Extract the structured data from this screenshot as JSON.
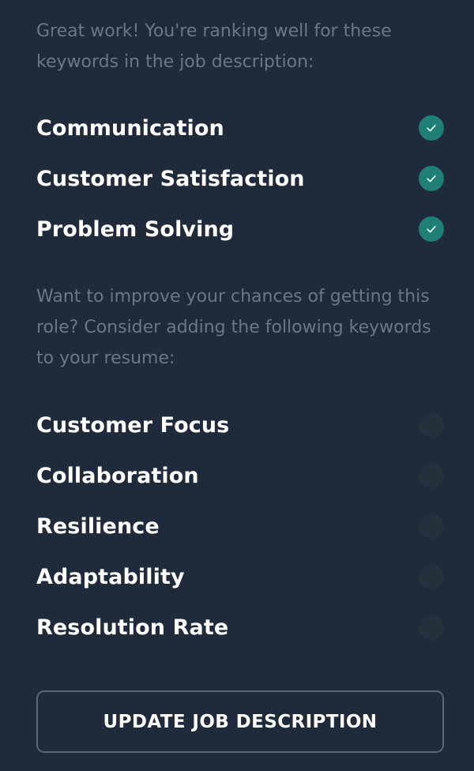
{
  "matched_section": {
    "intro": "Great work! You're ranking well for these keywords in the job description:",
    "keywords": [
      {
        "label": "Communication",
        "status": "matched",
        "icon": "check-icon"
      },
      {
        "label": "Customer Satisfaction",
        "status": "matched",
        "icon": "check-icon"
      },
      {
        "label": "Problem Solving",
        "status": "matched",
        "icon": "check-icon"
      }
    ]
  },
  "missing_section": {
    "intro": "Want to improve your chances of getting this role? Consider adding the following keywords to your resume:",
    "keywords": [
      {
        "label": "Customer Focus",
        "status": "missing"
      },
      {
        "label": "Collaboration",
        "status": "missing"
      },
      {
        "label": "Resilience",
        "status": "missing"
      },
      {
        "label": "Adaptability",
        "status": "missing"
      },
      {
        "label": "Resolution Rate",
        "status": "missing"
      }
    ]
  },
  "actions": {
    "update_label": "UPDATE JOB DESCRIPTION"
  },
  "colors": {
    "background": "#1f2a3b",
    "muted_text": "#6c7685",
    "check_fill": "#1f7f75",
    "empty_indicator": "#262f3c",
    "button_border": "#5b6575"
  }
}
